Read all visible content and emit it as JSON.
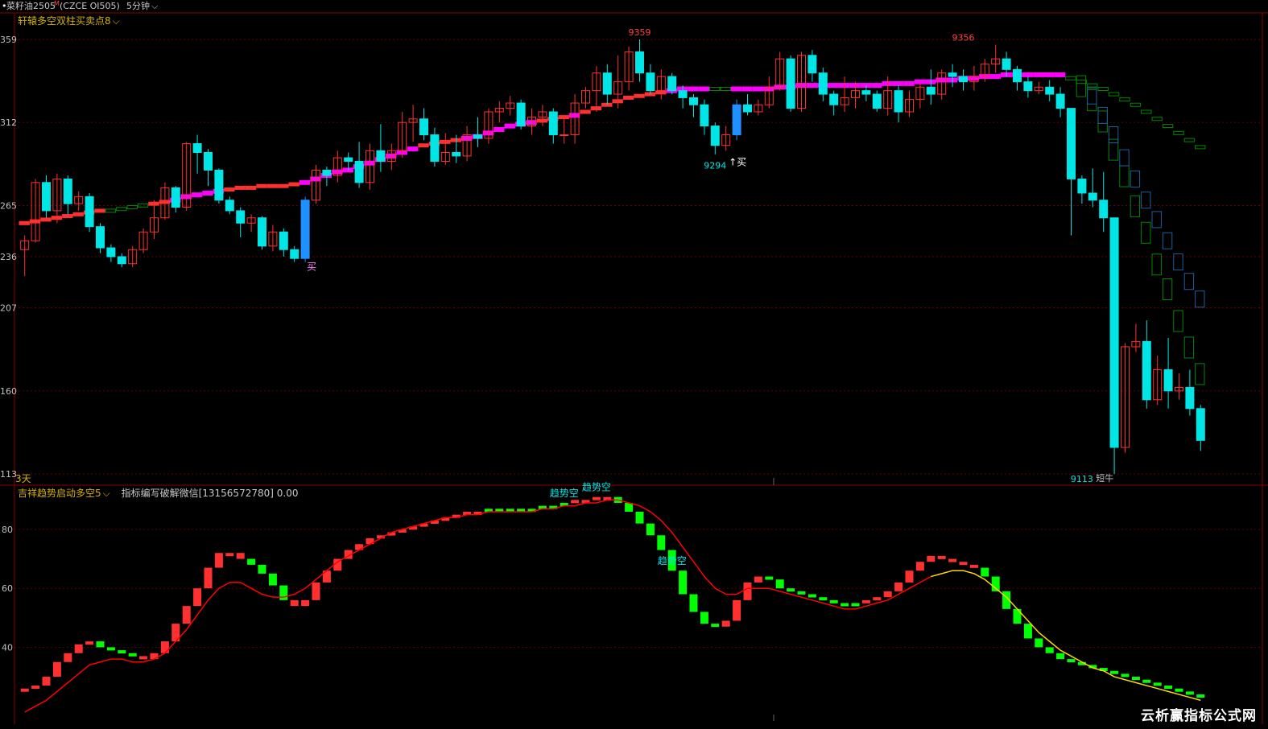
{
  "header": {
    "symbol": "菜籽油2505",
    "marker": "M",
    "code": "(CZCE OI505)",
    "period": "5分钟"
  },
  "main_panel": {
    "indicator_name": "轩辕多空双柱买卖点8",
    "y_ticks": [
      "359",
      "312",
      "265",
      "236",
      "207",
      "160",
      "113"
    ],
    "bottom_left_label": "3天",
    "annotations": {
      "high1": "9359",
      "high2": "9356",
      "low1": "9294",
      "low2": "9113",
      "buy1": "买",
      "buy2": "↑买",
      "bottom_note": "短牛"
    }
  },
  "sub_panel": {
    "indicator_name": "吉祥趋势启动多空5",
    "extra_text": "指标编写破解微信[13156572780] 0.00",
    "y_ticks": [
      "80",
      "60",
      "40"
    ],
    "labels": [
      "趋势空",
      "趋势空",
      "趋势空"
    ]
  },
  "watermark": "云析赢指标公式网",
  "colors": {
    "up": "#ff3030",
    "down": "#00e5e5",
    "blue_bar": "#1e90ff",
    "magenta": "#ff00ff",
    "red_line": "#ff0000",
    "green": "#00ff00",
    "yellow": "#ffd700",
    "grid": "#8b0000",
    "axis": "#8b0000",
    "gold_text": "#d4b000",
    "stair_green": "#008800",
    "stair_blue": "#1c5fa0"
  },
  "chart_data": [
    {
      "type": "candlestick",
      "ylim": [
        9113,
        9359
      ],
      "x_count": 110,
      "candles": [
        [
          9240,
          9245,
          9225,
          9248
        ],
        [
          9245,
          9278,
          9244,
          9280
        ],
        [
          9278,
          9262,
          9258,
          9282
        ],
        [
          9262,
          9280,
          9255,
          9283
        ],
        [
          9280,
          9266,
          9260,
          9282
        ],
        [
          9266,
          9270,
          9262,
          9273
        ],
        [
          9270,
          9253,
          9250,
          9272
        ],
        [
          9253,
          9241,
          9238,
          9255
        ],
        [
          9241,
          9236,
          9233,
          9243
        ],
        [
          9236,
          9232,
          9230,
          9238
        ],
        [
          9232,
          9240,
          9230,
          9242
        ],
        [
          9240,
          9250,
          9238,
          9252
        ],
        [
          9250,
          9258,
          9246,
          9268
        ],
        [
          9258,
          9275,
          9257,
          9278
        ],
        [
          9275,
          9264,
          9261,
          9276
        ],
        [
          9264,
          9300,
          9262,
          9301
        ],
        [
          9300,
          9295,
          9283,
          9305
        ],
        [
          9295,
          9285,
          9276,
          9297
        ],
        [
          9285,
          9268,
          9266,
          9286
        ],
        [
          9268,
          9262,
          9260,
          9270
        ],
        [
          9262,
          9255,
          9247,
          9264
        ],
        [
          9255,
          9258,
          9250,
          9260
        ],
        [
          9258,
          9242,
          9240,
          9259
        ],
        [
          9242,
          9250,
          9239,
          9254
        ],
        [
          9250,
          9240,
          9236,
          9252
        ],
        [
          9240,
          9235,
          9233,
          9242
        ],
        [
          9235,
          9268,
          9233,
          9270
        ],
        [
          9268,
          9285,
          9266,
          9288
        ],
        [
          9285,
          9282,
          9276,
          9287
        ],
        [
          9282,
          9292,
          9278,
          9296
        ],
        [
          9292,
          9290,
          9285,
          9295
        ],
        [
          9290,
          9278,
          9275,
          9301
        ],
        [
          9278,
          9296,
          9274,
          9300
        ],
        [
          9296,
          9290,
          9284,
          9311
        ],
        [
          9290,
          9296,
          9285,
          9300
        ],
        [
          9296,
          9312,
          9292,
          9318
        ],
        [
          9312,
          9314,
          9301,
          9322
        ],
        [
          9314,
          9305,
          9302,
          9320
        ],
        [
          9305,
          9290,
          9287,
          9309
        ],
        [
          9290,
          9295,
          9288,
          9306
        ],
        [
          9295,
          9293,
          9289,
          9305
        ],
        [
          9293,
          9305,
          9290,
          9310
        ],
        [
          9305,
          9303,
          9298,
          9315
        ],
        [
          9303,
          9318,
          9300,
          9320
        ],
        [
          9318,
          9320,
          9312,
          9324
        ],
        [
          9320,
          9323,
          9316,
          9327
        ],
        [
          9323,
          9310,
          9308,
          9325
        ],
        [
          9310,
          9315,
          9305,
          9320
        ],
        [
          9315,
          9318,
          9310,
          9322
        ],
        [
          9318,
          9305,
          9300,
          9320
        ],
        [
          9305,
          9305,
          9300,
          9315
        ],
        [
          9305,
          9323,
          9300,
          9328
        ],
        [
          9323,
          9330,
          9320,
          9332
        ],
        [
          9330,
          9340,
          9318,
          9344
        ],
        [
          9340,
          9328,
          9322,
          9345
        ],
        [
          9328,
          9335,
          9320,
          9350
        ],
        [
          9335,
          9352,
          9330,
          9355
        ],
        [
          9352,
          9340,
          9335,
          9359
        ],
        [
          9340,
          9330,
          9328,
          9345
        ],
        [
          9330,
          9338,
          9325,
          9342
        ],
        [
          9338,
          9330,
          9328,
          9340
        ],
        [
          9330,
          9326,
          9320,
          9333
        ],
        [
          9326,
          9322,
          9315,
          9328
        ],
        [
          9322,
          9310,
          9305,
          9325
        ],
        [
          9310,
          9299,
          9294,
          9312
        ],
        [
          9299,
          9305,
          9296,
          9310
        ],
        [
          9305,
          9322,
          9302,
          9325
        ],
        [
          9322,
          9318,
          9316,
          9328
        ],
        [
          9318,
          9322,
          9316,
          9325
        ],
        [
          9322,
          9332,
          9320,
          9338
        ],
        [
          9332,
          9348,
          9330,
          9352
        ],
        [
          9348,
          9320,
          9318,
          9350
        ],
        [
          9320,
          9350,
          9318,
          9352
        ],
        [
          9350,
          9340,
          9335,
          9353
        ],
        [
          9340,
          9328,
          9324,
          9343
        ],
        [
          9328,
          9322,
          9316,
          9330
        ],
        [
          9322,
          9326,
          9318,
          9338
        ],
        [
          9326,
          9330,
          9320,
          9335
        ],
        [
          9330,
          9328,
          9324,
          9333
        ],
        [
          9328,
          9320,
          9318,
          9330
        ],
        [
          9320,
          9330,
          9316,
          9338
        ],
        [
          9330,
          9318,
          9312,
          9333
        ],
        [
          9318,
          9325,
          9315,
          9330
        ],
        [
          9325,
          9332,
          9320,
          9334
        ],
        [
          9332,
          9328,
          9322,
          9342
        ],
        [
          9328,
          9340,
          9325,
          9342
        ],
        [
          9340,
          9338,
          9332,
          9345
        ],
        [
          9338,
          9335,
          9330,
          9342
        ],
        [
          9335,
          9338,
          9330,
          9344
        ],
        [
          9338,
          9345,
          9335,
          9348
        ],
        [
          9345,
          9348,
          9340,
          9356
        ],
        [
          9348,
          9342,
          9338,
          9352
        ],
        [
          9342,
          9335,
          9330,
          9344
        ],
        [
          9335,
          9330,
          9326,
          9338
        ],
        [
          9330,
          9332,
          9328,
          9335
        ],
        [
          9332,
          9328,
          9324,
          9336
        ],
        [
          9328,
          9320,
          9315,
          9332
        ],
        [
          9320,
          9280,
          9248,
          9300
        ],
        [
          9280,
          9272,
          9266,
          9282
        ],
        [
          9272,
          9268,
          9264,
          9286
        ],
        [
          9268,
          9258,
          9250,
          9284
        ],
        [
          9258,
          9128,
          9113,
          9258
        ],
        [
          9128,
          9185,
          9125,
          9187
        ],
        [
          9185,
          9188,
          9182,
          9198
        ],
        [
          9188,
          9155,
          9150,
          9200
        ],
        [
          9155,
          9172,
          9152,
          9180
        ],
        [
          9172,
          9160,
          9150,
          9190
        ],
        [
          9160,
          9162,
          9155,
          9170
        ],
        [
          9162,
          9150,
          9146,
          9172
        ],
        [
          9150,
          9132,
          9126,
          9152
        ]
      ],
      "blue_bars": [
        26,
        66
      ],
      "ma_support": [
        9255,
        9256,
        9257,
        9258,
        9259,
        9260,
        9261,
        9262,
        9262,
        9263,
        9264,
        9265,
        9266,
        9267,
        9268,
        9270,
        9271,
        9272,
        9273,
        9274,
        9275,
        9275,
        9276,
        9276,
        9276,
        9277,
        9278,
        9280,
        9282,
        9284,
        9285,
        9287,
        9289,
        9291,
        9293,
        9295,
        9297,
        9299,
        9300,
        9301,
        9302,
        9303,
        9304,
        9306,
        9308,
        9310,
        9311,
        9312,
        9313,
        9314,
        9315,
        9316,
        9318,
        9320,
        9322,
        9324,
        9326,
        9327,
        9328,
        9329,
        9330,
        9331,
        9331,
        9331,
        9331,
        9331,
        9331,
        9331,
        9331,
        9331,
        9332,
        9332,
        9333,
        9333,
        9333,
        9333,
        9333,
        9333,
        9333,
        9333,
        9334,
        9334,
        9334,
        9335,
        9335,
        9336,
        9336,
        9337,
        9337,
        9338,
        9338,
        9339,
        9339,
        9339,
        9339,
        9339,
        9339,
        9337,
        9335,
        9333,
        9331,
        9328,
        9325,
        9322,
        9318,
        9314,
        9310,
        9306,
        9302,
        9298
      ],
      "ma_support_color": [
        "r",
        "r",
        "r",
        "r",
        "r",
        "r",
        "r",
        "r",
        "g",
        "g",
        "g",
        "g",
        "r",
        "r",
        "m",
        "m",
        "m",
        "m",
        "m",
        "r",
        "r",
        "r",
        "r",
        "r",
        "r",
        "r",
        "m",
        "m",
        "m",
        "m",
        "m",
        "m",
        "m",
        "m",
        "m",
        "m",
        "m",
        "r",
        "r",
        "r",
        "r",
        "m",
        "m",
        "m",
        "m",
        "m",
        "m",
        "m",
        "r",
        "r",
        "r",
        "m",
        "r",
        "r",
        "r",
        "r",
        "r",
        "r",
        "r",
        "r",
        "m",
        "m",
        "m",
        "m",
        "g",
        "g",
        "m",
        "m",
        "m",
        "m",
        "m",
        "m",
        "m",
        "m",
        "m",
        "m",
        "m",
        "m",
        "m",
        "m",
        "m",
        "m",
        "m",
        "m",
        "m",
        "m",
        "m",
        "m",
        "m",
        "m",
        "m",
        "m",
        "m",
        "m",
        "m",
        "m",
        "m",
        "g",
        "g",
        "g",
        "g",
        "g",
        "g",
        "g",
        "g",
        "g",
        "g",
        "g",
        "g",
        "g"
      ],
      "stair_green": [
        [
          98,
          9333
        ],
        [
          99,
          9325
        ],
        [
          100,
          9313
        ],
        [
          101,
          9297
        ],
        [
          102,
          9282
        ],
        [
          103,
          9265
        ],
        [
          104,
          9250
        ],
        [
          105,
          9232
        ],
        [
          106,
          9218
        ],
        [
          107,
          9200
        ],
        [
          108,
          9185
        ],
        [
          109,
          9170
        ]
      ],
      "stair_blue": [
        [
          99,
          9327
        ],
        [
          100,
          9316
        ],
        [
          101,
          9305
        ],
        [
          102,
          9292
        ],
        [
          103,
          9280
        ],
        [
          104,
          9268
        ],
        [
          105,
          9257
        ],
        [
          106,
          9245
        ],
        [
          107,
          9233
        ],
        [
          108,
          9222
        ],
        [
          109,
          9212
        ]
      ]
    },
    {
      "type": "bar",
      "ylim": [
        15,
        95
      ],
      "x_count": 110,
      "values": [
        26,
        27,
        30,
        35,
        38,
        41,
        42,
        40,
        39,
        38,
        37,
        36,
        38,
        42,
        48,
        54,
        60,
        67,
        72,
        72,
        70,
        68,
        65,
        61,
        56,
        54,
        56,
        62,
        66,
        70,
        73,
        75,
        77,
        78,
        79,
        80,
        81,
        82,
        83,
        84,
        85,
        86,
        86,
        87,
        87,
        87,
        87,
        87,
        88,
        88,
        89,
        90,
        90,
        91,
        91,
        89,
        86,
        82,
        78,
        73,
        66,
        58,
        52,
        48,
        47,
        49,
        56,
        62,
        64,
        63,
        60,
        59,
        58,
        57,
        56,
        55,
        55,
        55,
        56,
        57,
        59,
        62,
        66,
        69,
        71,
        70,
        69,
        68,
        67,
        64,
        59,
        53,
        48,
        43,
        40,
        38,
        36,
        35,
        34,
        33,
        32,
        31,
        30,
        29,
        28,
        27,
        26,
        25,
        24,
        23
      ],
      "bar_color": [
        "r",
        "r",
        "r",
        "r",
        "r",
        "r",
        "r",
        "g",
        "g",
        "g",
        "g",
        "r",
        "r",
        "r",
        "r",
        "r",
        "r",
        "r",
        "r",
        "r",
        "r",
        "g",
        "g",
        "g",
        "g",
        "r",
        "r",
        "r",
        "r",
        "r",
        "r",
        "r",
        "r",
        "r",
        "r",
        "r",
        "r",
        "r",
        "r",
        "r",
        "r",
        "r",
        "r",
        "g",
        "g",
        "g",
        "g",
        "g",
        "g",
        "g",
        "g",
        "r",
        "r",
        "r",
        "r",
        "g",
        "g",
        "g",
        "g",
        "g",
        "g",
        "g",
        "g",
        "g",
        "g",
        "r",
        "r",
        "r",
        "r",
        "g",
        "g",
        "g",
        "g",
        "g",
        "g",
        "g",
        "g",
        "g",
        "r",
        "r",
        "r",
        "r",
        "r",
        "r",
        "r",
        "r",
        "r",
        "r",
        "r",
        "g",
        "g",
        "g",
        "g",
        "g",
        "g",
        "g",
        "g",
        "g",
        "g",
        "g",
        "g",
        "g",
        "g",
        "g",
        "g",
        "g",
        "g",
        "g",
        "g",
        "g"
      ],
      "series": [
        {
          "color": "red_line",
          "values": [
            18,
            20,
            22,
            25,
            28,
            31,
            34,
            35,
            36,
            36,
            35,
            35,
            36,
            38,
            42,
            46,
            51,
            56,
            60,
            62,
            62,
            60,
            58,
            57,
            57,
            58,
            60,
            63,
            66,
            69,
            71,
            73,
            75,
            77,
            79,
            80,
            81,
            82,
            83,
            84,
            84,
            85,
            85,
            86,
            86,
            86,
            86,
            86,
            87,
            87,
            88,
            88,
            89,
            89,
            90,
            90,
            89,
            88,
            86,
            83,
            79,
            74,
            69,
            64,
            60,
            58,
            58,
            60,
            60,
            60,
            59,
            58,
            57,
            56,
            55,
            54,
            53,
            53,
            54,
            55,
            56,
            58,
            60,
            62,
            64,
            65,
            66,
            66,
            65,
            63,
            60,
            57,
            53,
            49,
            45,
            42,
            39,
            37,
            35,
            33,
            32,
            30,
            29,
            28,
            27,
            26,
            25,
            24,
            23,
            22
          ],
          "red_until": 84
        },
        {
          "color": "yellow",
          "values": [
            null
          ]
        }
      ],
      "trend_labels_at": [
        50,
        53,
        60
      ]
    }
  ]
}
